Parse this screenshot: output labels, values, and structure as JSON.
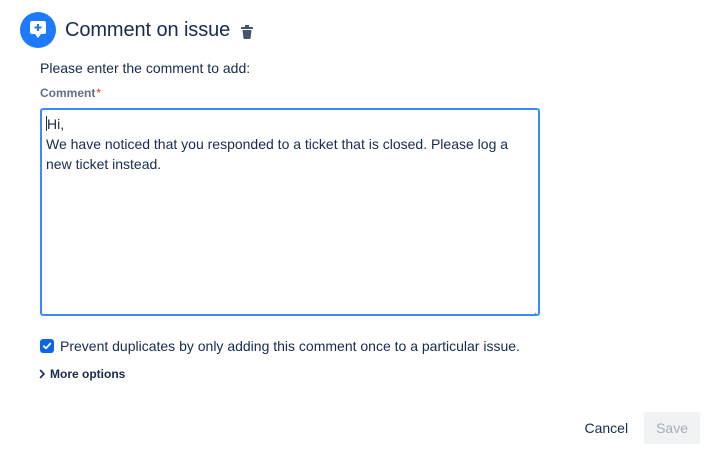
{
  "header": {
    "title": "Comment on issue",
    "icon": "comment-plus-icon",
    "accent_color": "#1d7afc",
    "delete_icon": "trash-icon"
  },
  "form": {
    "prompt": "Please enter the comment to add:",
    "comment_label": "Comment",
    "required_marker": "*",
    "comment_lines": [
      "Hi,",
      "We have noticed that you responded to a ticket that is closed. Please log a",
      "new ticket instead."
    ],
    "prevent_duplicates": {
      "checked": true,
      "label": "Prevent duplicates by only adding this comment once to a particular issue."
    },
    "more_options_label": "More options"
  },
  "footer": {
    "cancel_label": "Cancel",
    "save_label": "Save"
  }
}
